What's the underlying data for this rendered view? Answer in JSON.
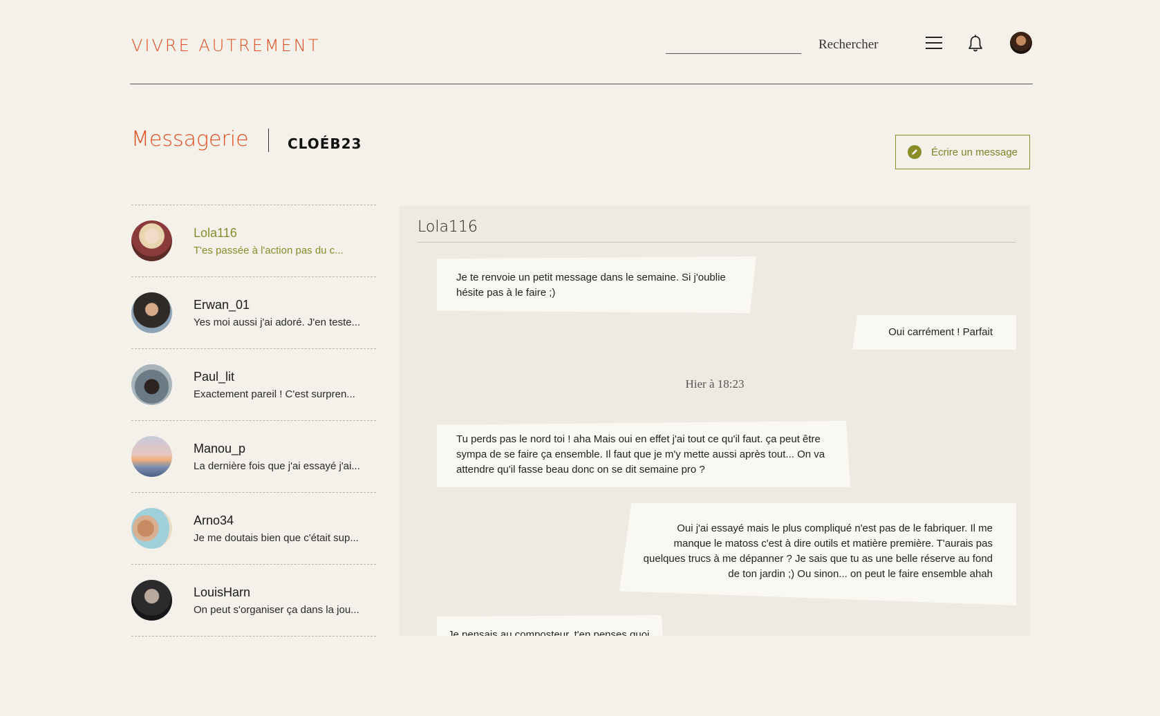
{
  "header": {
    "logo": "VIVRE AUTREMENT",
    "search_value": "",
    "search_label": "Rechercher"
  },
  "page": {
    "title": "Messagerie",
    "username": "CLOÉB23",
    "write_button": "Écrire un message"
  },
  "conversations": [
    {
      "name": "Lola116",
      "preview": "T'es passée à l'action pas du c...",
      "active": true
    },
    {
      "name": "Erwan_01",
      "preview": "Yes moi aussi j'ai adoré. J'en teste...",
      "active": false
    },
    {
      "name": "Paul_lit",
      "preview": "Exactement pareil ! C'est surpren...",
      "active": false
    },
    {
      "name": "Manou_p",
      "preview": "La dernière fois que j'ai essayé j'ai...",
      "active": false
    },
    {
      "name": "Arno34",
      "preview": "Je me doutais bien que c'était sup...",
      "active": false
    },
    {
      "name": "LouisHarn",
      "preview": "On peut s'organiser ça dans la jou...",
      "active": false
    }
  ],
  "chat": {
    "contact": "Lola116",
    "messages": [
      {
        "from": "contact",
        "text": "Je te renvoie un petit message dans le semaine. Si j'oublie hésite pas à le faire ;)"
      },
      {
        "from": "me",
        "text": "Oui carrément ! Parfait"
      },
      {
        "from": "contact",
        "text": "Tu perds pas le nord toi ! aha Mais oui en effet j'ai tout ce qu'il faut. ça peut être sympa de se faire ça ensemble. Il faut que je m'y mette aussi après tout... On va attendre qu'il fasse beau donc on se dit semaine pro ?"
      },
      {
        "from": "me",
        "text": "Oui j'ai essayé mais le plus compliqué n'est pas de le fabriquer. Il me manque le matoss c'est à dire outils et matière première. T'aurais pas quelques trucs à me dépanner ? Je sais que tu as une belle réserve au fond de ton jardin ;) Ou sinon... on peut le faire ensemble ahah"
      },
      {
        "from": "contact",
        "text": "Je pensais au composteur, t'en penses quoi ?"
      }
    ],
    "timestamp": "Hier à 18:23"
  },
  "colors": {
    "brand": "#e04e1f",
    "accent": "#8a8c2a",
    "background": "#f4f1ea"
  }
}
